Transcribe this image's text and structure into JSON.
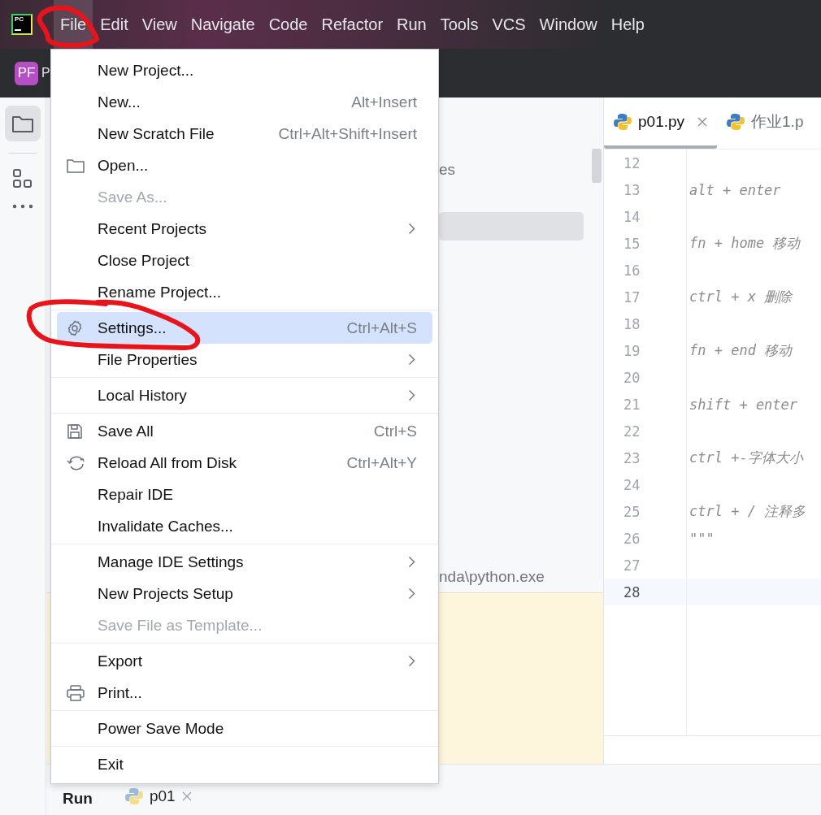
{
  "logo": {
    "text": "PC"
  },
  "menubar": [
    {
      "label": "File",
      "selected": true
    },
    {
      "label": "Edit",
      "selected": false
    },
    {
      "label": "View",
      "selected": false
    },
    {
      "label": "Navigate",
      "selected": false
    },
    {
      "label": "Code",
      "selected": false
    },
    {
      "label": "Refactor",
      "selected": false
    },
    {
      "label": "Run",
      "selected": false
    },
    {
      "label": "Tools",
      "selected": false
    },
    {
      "label": "VCS",
      "selected": false
    },
    {
      "label": "Window",
      "selected": false
    },
    {
      "label": "Help",
      "selected": false
    }
  ],
  "toolbar": {
    "project_badge": "PF",
    "project_name": "P"
  },
  "project_panel": {
    "tree_item": "es",
    "interpreter_path": "nda\\python.exe"
  },
  "editor": {
    "tabs": [
      {
        "label": "p01.py",
        "selected": true,
        "closable": true
      },
      {
        "label": "作业1.p",
        "selected": false,
        "closable": false
      }
    ],
    "lines": [
      {
        "number": "12",
        "current": false
      },
      {
        "number": "13",
        "code": "alt + enter",
        "current": false
      },
      {
        "number": "14",
        "current": false
      },
      {
        "number": "15",
        "code": "fn + home 移动",
        "current": false
      },
      {
        "number": "16",
        "current": false
      },
      {
        "number": "17",
        "code": "ctrl + x 删除",
        "current": false
      },
      {
        "number": "18",
        "current": false
      },
      {
        "number": "19",
        "code": "fn + end  移动",
        "current": false
      },
      {
        "number": "20",
        "current": false
      },
      {
        "number": "21",
        "code": "shift + enter",
        "current": false
      },
      {
        "number": "22",
        "current": false
      },
      {
        "number": "23",
        "code": "ctrl +-字体大小",
        "current": false
      },
      {
        "number": "24",
        "current": false
      },
      {
        "number": "25",
        "code": "ctrl + / 注释多",
        "current": false
      },
      {
        "number": "26",
        "code": "\"\"\"",
        "current": false
      },
      {
        "number": "27",
        "current": false
      },
      {
        "number": "28",
        "current": true
      }
    ]
  },
  "run_bar": {
    "title": "Run",
    "tab": "p01"
  },
  "file_menu": [
    {
      "kind": "item",
      "label": "New Project...",
      "selected": false,
      "disabled": false,
      "submenu": false
    },
    {
      "kind": "item",
      "label": "New...",
      "shortcut": "Alt+Insert",
      "selected": false,
      "disabled": false,
      "submenu": false
    },
    {
      "kind": "item",
      "label": "New Scratch File",
      "shortcut": "Ctrl+Alt+Shift+Insert",
      "selected": false,
      "disabled": false,
      "submenu": false
    },
    {
      "kind": "item",
      "label": "Open...",
      "selected": false,
      "disabled": false,
      "submenu": false
    },
    {
      "kind": "item",
      "label": "Save As...",
      "selected": false,
      "disabled": true,
      "submenu": false
    },
    {
      "kind": "item",
      "label": "Recent Projects",
      "selected": false,
      "disabled": false,
      "submenu": true
    },
    {
      "kind": "item",
      "label": "Close Project",
      "selected": false,
      "disabled": false,
      "submenu": false
    },
    {
      "kind": "item",
      "label": "Rename Project...",
      "selected": false,
      "disabled": false,
      "submenu": false
    },
    {
      "kind": "separator"
    },
    {
      "kind": "item",
      "label": "Settings...",
      "shortcut": "Ctrl+Alt+S",
      "selected": true,
      "disabled": false,
      "submenu": false
    },
    {
      "kind": "item",
      "label": "File Properties",
      "selected": false,
      "disabled": false,
      "submenu": true
    },
    {
      "kind": "separator"
    },
    {
      "kind": "item",
      "label": "Local History",
      "selected": false,
      "disabled": false,
      "submenu": true
    },
    {
      "kind": "separator"
    },
    {
      "kind": "item",
      "label": "Save All",
      "shortcut": "Ctrl+S",
      "selected": false,
      "disabled": false,
      "submenu": false
    },
    {
      "kind": "item",
      "label": "Reload All from Disk",
      "shortcut": "Ctrl+Alt+Y",
      "selected": false,
      "disabled": false,
      "submenu": false
    },
    {
      "kind": "item",
      "label": "Repair IDE",
      "selected": false,
      "disabled": false,
      "submenu": false
    },
    {
      "kind": "item",
      "label": "Invalidate Caches...",
      "selected": false,
      "disabled": false,
      "submenu": false
    },
    {
      "kind": "separator"
    },
    {
      "kind": "item",
      "label": "Manage IDE Settings",
      "selected": false,
      "disabled": false,
      "submenu": true
    },
    {
      "kind": "item",
      "label": "New Projects Setup",
      "selected": false,
      "disabled": false,
      "submenu": true
    },
    {
      "kind": "item",
      "label": "Save File as Template...",
      "selected": false,
      "disabled": true,
      "submenu": false
    },
    {
      "kind": "separator"
    },
    {
      "kind": "item",
      "label": "Export",
      "selected": false,
      "disabled": false,
      "submenu": true
    },
    {
      "kind": "item",
      "label": "Print...",
      "selected": false,
      "disabled": false,
      "submenu": false
    },
    {
      "kind": "separator"
    },
    {
      "kind": "item",
      "label": "Power Save Mode",
      "selected": false,
      "disabled": false,
      "submenu": false
    },
    {
      "kind": "separator"
    },
    {
      "kind": "item",
      "label": "Exit",
      "selected": false,
      "disabled": false,
      "submenu": false
    }
  ]
}
